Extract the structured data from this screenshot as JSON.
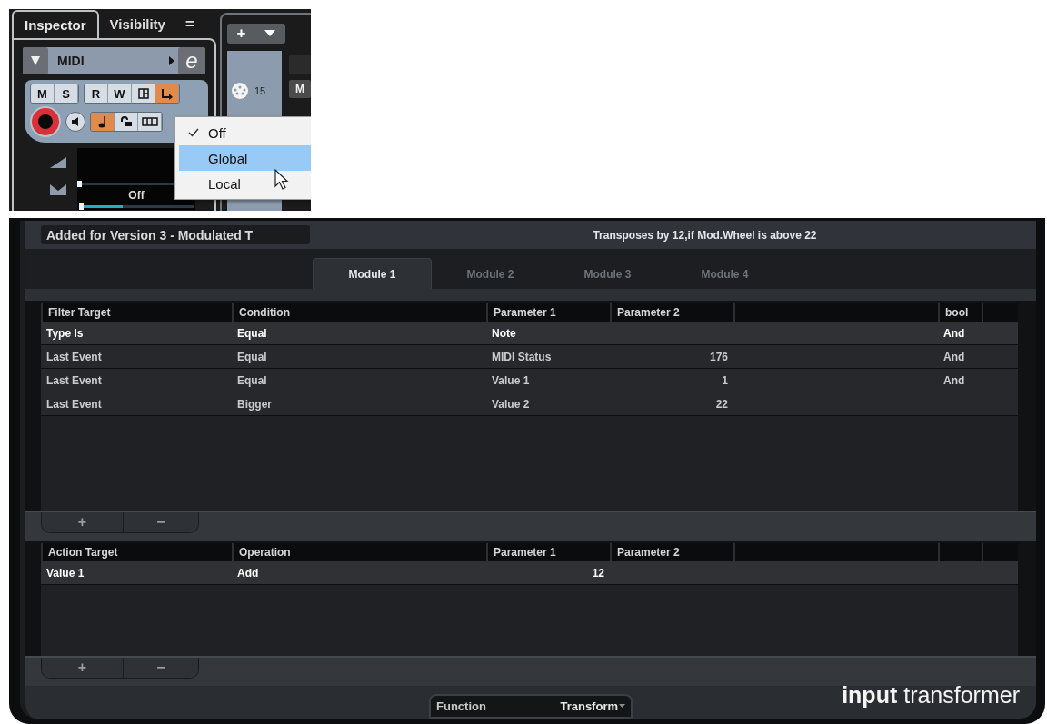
{
  "inspector": {
    "tabs": [
      {
        "label": "Inspector",
        "selected": true
      },
      {
        "label": "Visibility",
        "selected": false
      }
    ],
    "tab_menu_glyph": "=",
    "track": {
      "name": "MIDI",
      "edit_glyph": "e"
    },
    "mute_solo": [
      {
        "label": "M",
        "on": false
      },
      {
        "label": "S",
        "on": false
      }
    ],
    "tools": [
      {
        "kind": "text",
        "label": "R",
        "on": false
      },
      {
        "kind": "text",
        "label": "W",
        "on": false
      },
      {
        "kind": "grid",
        "on": false
      },
      {
        "kind": "route",
        "on": true
      }
    ],
    "row2": [
      {
        "kind": "note",
        "on": true
      },
      {
        "kind": "lock",
        "on": false
      },
      {
        "kind": "bars",
        "on": false
      }
    ],
    "sliders": [
      {
        "level": 0.0
      },
      {
        "level": 0.38
      }
    ],
    "pan_display": "Off",
    "add_glyph": "+",
    "track_number": "15",
    "mute_glyph": "M",
    "popup": [
      {
        "label": "Off",
        "checked": true,
        "selected": false
      },
      {
        "label": "Global",
        "checked": false,
        "selected": true
      },
      {
        "label": "Local",
        "checked": false,
        "selected": false
      }
    ]
  },
  "transformer": {
    "preset": "Added for Version 3 - Modulated T",
    "description": "Transposes by 12,if Mod.Wheel is above 22",
    "modules": [
      {
        "label": "Module 1",
        "selected": true
      },
      {
        "label": "Module 2",
        "selected": false
      },
      {
        "label": "Module 3",
        "selected": false
      },
      {
        "label": "Module 4",
        "selected": false
      }
    ],
    "filter_table": {
      "columns": [
        "Filter Target",
        "Condition",
        "Parameter 1",
        "Parameter 2",
        "bool"
      ],
      "rows": [
        {
          "target": "Type Is",
          "condition": "Equal",
          "parameter_1": "Note",
          "bool": "And",
          "selected": true
        },
        {
          "target": "Last Event",
          "condition": "Equal",
          "parameter_1": "MIDI Status",
          "parameter_2": "176",
          "bool": "And",
          "selected": false
        },
        {
          "target": "Last Event",
          "condition": "Equal",
          "parameter_1": "Value 1",
          "parameter_2": "1",
          "bool": "And",
          "selected": false
        },
        {
          "target": "Last Event",
          "condition": "Bigger",
          "parameter_1": "Value 2",
          "parameter_2": "22",
          "selected": false
        }
      ]
    },
    "filter_buttons": [
      "+",
      "−"
    ],
    "action_table": {
      "columns": [
        "Action Target",
        "Operation",
        "Parameter 1",
        "Parameter 2"
      ],
      "rows": [
        {
          "target": "Value 1",
          "operation": "Add",
          "parameter_1": "12",
          "selected": true
        }
      ]
    },
    "action_buttons": [
      "+",
      "−"
    ],
    "function_label": "Function",
    "function_value": "Transform",
    "logo": "**input** transformer"
  }
}
